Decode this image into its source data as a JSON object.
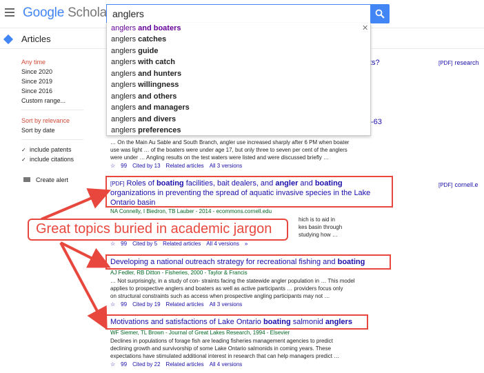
{
  "header": {
    "logo_google": "Google",
    "logo_scholar": "Scholar",
    "search_value": "anglers"
  },
  "articles_label": "Articles",
  "sidebar": {
    "time_filters": [
      "Any time",
      "Since 2020",
      "Since 2019",
      "Since 2016",
      "Custom range..."
    ],
    "sort": [
      "Sort by relevance",
      "Sort by date"
    ],
    "checks": [
      "include patents",
      "include citations"
    ],
    "create_alert": "Create alert"
  },
  "autocomplete": [
    {
      "base": "anglers",
      "bold": " and boaters"
    },
    {
      "base": "anglers",
      "bold": " catches"
    },
    {
      "base": "anglers",
      "bold": " guide"
    },
    {
      "base": "anglers",
      "bold": " with catch"
    },
    {
      "base": "anglers",
      "bold": " and hunters"
    },
    {
      "base": "anglers",
      "bold": " willingness"
    },
    {
      "base": "anglers",
      "bold": " and others"
    },
    {
      "base": "anglers",
      "bold": " and managers"
    },
    {
      "base": "anglers",
      "bold": " and divers"
    },
    {
      "base": "anglers",
      "bold": " preferences"
    }
  ],
  "partial": {
    "ts": "ts?",
    "num": "-63"
  },
  "right_links": {
    "r1_tag": "[PDF]",
    "r1_text": "research",
    "r2_tag": "[PDF]",
    "r2_text": "cornell.e"
  },
  "result0": {
    "s1": "… On the Main Au Sable and South Branch, angler use increased sharply after 6 PM when boater",
    "s2": "use was light … of the boaters were under age 17, but only three to seven per cent of the anglers",
    "s3": "were under … Angling results on the test waters were listed and were discussed briefly …",
    "cited": "Cited by 13",
    "related": "Related articles",
    "versions": "All 3 versions"
  },
  "result1": {
    "pdf": "[PDF]",
    "t1a": "Roles of ",
    "t1b": "boating",
    "t1c": " facilities, bait dealers, and ",
    "t1d": "angler",
    "t1e": " and ",
    "t1f": "boating",
    "t2": "organizations in preventing the spread of aquatic invasive species in the Lake",
    "t3": "Ontario basin",
    "meta": "NA Connelly, I Biedron, TB Lauber - 2014 - ecommons.cornell.edu",
    "s1": "hich is to aid in",
    "s2": "kes basin through",
    "s3": "studying how …",
    "cited": "Cited by 5",
    "related": "Related articles",
    "versions": "All 4 versions"
  },
  "result2": {
    "ta": "Developing a national outreach strategy for recreational fishing and ",
    "tb": "boating",
    "meta": "AJ Fedler, RB Ditton - Fisheries, 2000 - Taylor & Francis",
    "s1": "… Not surprisingly, in a study of con- straints facing the statewide angler population in … This model",
    "s2": "applies to prospective anglers and boaters as well as active participants … providers focus only",
    "s3": "on structural constraints such as access when prospective angling participants may not …",
    "cited": "Cited by 19",
    "related": "Related articles",
    "versions": "All 3 versions"
  },
  "result3": {
    "ta": "Motivations and satisfactions of Lake Ontario ",
    "tb": "boating",
    "tc": " salmonid ",
    "td": "anglers",
    "meta": "WF Siemer, TL Brown - Journal of Great Lakes Research, 1994 - Elsevier",
    "s1": "Declines in populations of forage fish are leading fisheries management agencies to predict",
    "s2": "declining growth and survivorship of some Lake Ontario salmonids in coming years. These",
    "s3": "expectations have stimulated additional interest in research that can help managers predict …",
    "cited": "Cited by 22",
    "related": "Related articles",
    "versions": "All 4 versions"
  },
  "callout": "Great topics buried in academic jargon",
  "colors": {
    "link": "#1a0dab",
    "accent": "#4285f4",
    "annotation": "#e8473d"
  }
}
